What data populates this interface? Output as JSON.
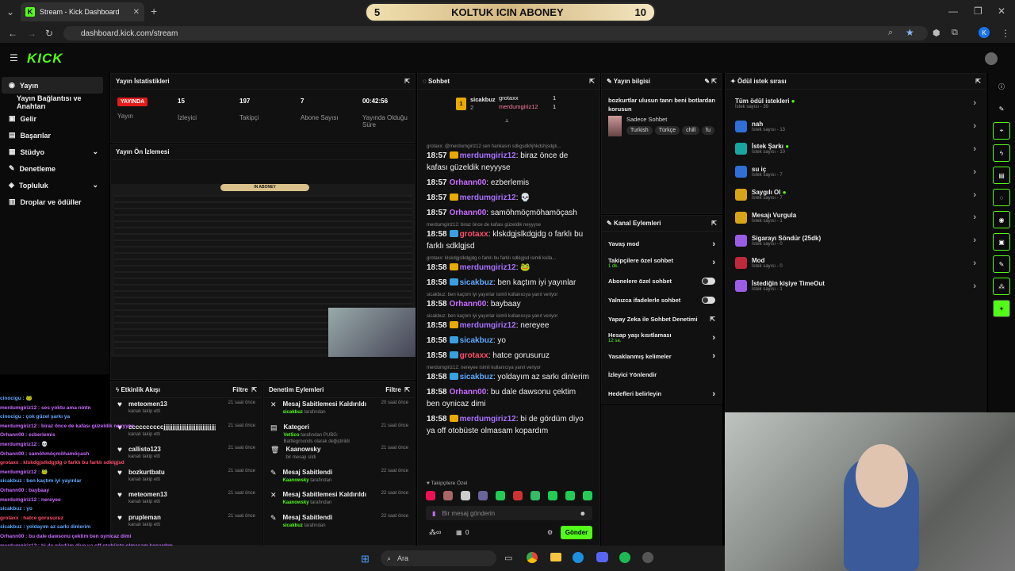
{
  "browser": {
    "tab_title": "Stream - Kick Dashboard",
    "url": "dashboard.kick.com/stream"
  },
  "overlay": {
    "left_num": "5",
    "title": "KOLTUK ICIN ABONEY",
    "right_num": "10"
  },
  "sidebar": {
    "items": [
      {
        "label": "Yayın"
      },
      {
        "label": "Yayın Bağlantısı ve Anahtarı"
      },
      {
        "label": "Gelir"
      },
      {
        "label": "Başarılar"
      },
      {
        "label": "Stüdyo"
      },
      {
        "label": "Denetleme"
      },
      {
        "label": "Topluluk"
      },
      {
        "label": "Droplar ve ödüller"
      }
    ]
  },
  "stats": {
    "title": "Yayın İstatistikleri",
    "live": "YAYINDA",
    "stream_label": "Yayın",
    "viewers": "15",
    "viewers_label": "İzleyici",
    "followers": "197",
    "followers_label": "Takipçi",
    "subs": "7",
    "subs_label": "Abone Sayısı",
    "duration": "00:42:56",
    "duration_label": "Yayında Olduğu Süre"
  },
  "preview": {
    "title": "Yayın Ön İzlemesi",
    "inner_title": "IN ABONEY",
    "inner_num": "10"
  },
  "activity": {
    "title": "Etkinlik Akışı",
    "filter": "Filtre",
    "rows": [
      {
        "name": "meteomen13",
        "sub": "kanalı takip etti",
        "time": "21 saat önce"
      },
      {
        "name": "ccccccccccjjjjjjjjjjjjjjjjjjjjjjjjjjjjjjjjjjjjjjjj",
        "sub": "kanalı takip etti",
        "time": "21 saat önce"
      },
      {
        "name": "callisto123",
        "sub": "kanalı takip etti",
        "time": "21 saat önce"
      },
      {
        "name": "bozkurtbatu",
        "sub": "kanalı takip etti",
        "time": "21 saat önce"
      },
      {
        "name": "meteomen13",
        "sub": "kanalı takip etti",
        "time": "21 saat önce"
      },
      {
        "name": "prupleman",
        "sub": "kanalı takip etti",
        "time": "21 saat önce"
      }
    ]
  },
  "moderation": {
    "title": "Denetim Eylemleri",
    "filter": "Filtre",
    "rows": [
      {
        "title": "Mesaj Sabitlemesi Kaldırıldı",
        "user": "sicakbuz",
        "rest": "tarafından",
        "time": "20 saat önce"
      },
      {
        "title": "Kategori",
        "user": "VetSco",
        "rest": "tarafından PUBG: Battlegrounds olarak değiştirildi",
        "time": "21 saat önce"
      },
      {
        "title": "Kaanowsky",
        "user": "",
        "rest": "bir mesajı sildi",
        "time": "21 saat önce"
      },
      {
        "title": "Mesaj Sabitlendi",
        "user": "Kaanowsky",
        "rest": "tarafından",
        "time": "22 saat önce"
      },
      {
        "title": "Mesaj Sabitlemesi Kaldırıldı",
        "user": "Kaanowsky",
        "rest": "tarafından",
        "time": "22 saat önce"
      },
      {
        "title": "Mesaj Sabitlendi",
        "user": "sicakbuz",
        "rest": "tarafından",
        "time": "22 saat önce"
      }
    ]
  },
  "chat": {
    "title": "Sohbet",
    "top1": "sicakbuz",
    "top1c": "1",
    "top2": "grotaxx",
    "top2c": "1",
    "top3": "merdumgiriz12",
    "top3c": "1",
    "rank2": "2",
    "rank3": "3",
    "followers_only": "Takipçilere Özel",
    "placeholder": "Bir mesaj gönderin",
    "send": "Gönder",
    "count": "0",
    "messages": [
      {
        "reply": "grotaxx: @merdumgiriz12 sen hankasın sdkgsdkhjhkdshjsdgk...",
        "time": "18:57",
        "user": "merdumgiriz12",
        "cls": "u1",
        "text": "biraz önce de kafası güzeldik neyyyse"
      },
      {
        "reply": "",
        "time": "18:57",
        "user": "Orhann00",
        "cls": "u2",
        "text": "ezberlemis"
      },
      {
        "reply": "",
        "time": "18:57",
        "user": "merdumgiriz12",
        "cls": "u1",
        "text": "💀"
      },
      {
        "reply": "",
        "time": "18:57",
        "user": "Orhann00",
        "cls": "u2",
        "text": "samöhmöçmöhamöçash"
      },
      {
        "reply": "merdumgiriz12: biraz önce de kafası güzeldik neyyyse",
        "time": "18:58",
        "user": "grotaxx",
        "cls": "u4",
        "text": "klskdgjslkdgjdg o farklı bu farklı sdklgjsd"
      },
      {
        "reply": "grotaxx: klskdgjslkdgjdg o farklı bu farklı sdklgjsd isimli kulla...",
        "time": "18:58",
        "user": "merdumgiriz12",
        "cls": "u1",
        "text": "🐸"
      },
      {
        "reply": "",
        "time": "18:58",
        "user": "sicakbuz",
        "cls": "u3",
        "text": "ben kaçtım iyi yayınlar"
      },
      {
        "reply": "sicakbuz: ben kaçtım iyi yayınlar isimli kullanıcıya yanıt veriyor",
        "time": "18:58",
        "user": "Orhann00",
        "cls": "u2",
        "text": "baybaay"
      },
      {
        "reply": "sicakbuz: ben kaçtım iyi yayınlar isimli kullanıcıya yanıt veriyor",
        "time": "18:58",
        "user": "merdumgiriz12",
        "cls": "u1",
        "text": "nereyee"
      },
      {
        "reply": "",
        "time": "18:58",
        "user": "sicakbuz",
        "cls": "u3",
        "text": "yo"
      },
      {
        "reply": "",
        "time": "18:58",
        "user": "grotaxx",
        "cls": "u4",
        "text": "hatce gorusuruz"
      },
      {
        "reply": "merdumgiriz12: nereyee isimli kullanıcıya yanıt veriyor",
        "time": "18:58",
        "user": "sicakbuz",
        "cls": "u3",
        "text": "yoldayım az sarkı dinlerim"
      },
      {
        "reply": "",
        "time": "18:58",
        "user": "Orhann00",
        "cls": "u2",
        "text": "bu dale dawsonu çektim ben oynicaz dimi"
      },
      {
        "reply": "",
        "time": "18:58",
        "user": "merdumgiriz12",
        "cls": "u1",
        "text": "bi de gördüm diyo ya off otobüste olmasam kopardım"
      }
    ]
  },
  "stream_info": {
    "title": "Yayın bilgisi",
    "desc": "bozkurtlar ulusun tanrı beni botlardan korusun",
    "chat_mode": "Sadece Sohbet",
    "tags": [
      "Turkish",
      "Türkçe",
      "chill",
      "fu"
    ]
  },
  "channel_actions": {
    "title": "Kanal Eylemleri",
    "rows": [
      {
        "label": "Yavaş mod",
        "sub": ""
      },
      {
        "label": "Takipçilere özel sohbet",
        "sub": "1 dk."
      },
      {
        "label": "Abonelere özel sohbet",
        "sub": ""
      },
      {
        "label": "Yalnızca ifadelerle sohbet",
        "sub": ""
      },
      {
        "label": "Yapay Zeka ile Sohbet Denetimi",
        "sub": ""
      },
      {
        "label": "Hesap yaşı kısıtlaması",
        "sub": "12 sa."
      },
      {
        "label": "Yasaklanmış kelimeler",
        "sub": ""
      },
      {
        "label": "İzleyici Yönlendir",
        "sub": ""
      },
      {
        "label": "Hedefleri belirleyin",
        "sub": ""
      }
    ]
  },
  "rewards": {
    "title": "Ödül istek sırası",
    "all": "Tüm ödül istekleri",
    "all_count": "İstek sayısı - 39",
    "items": [
      {
        "name": "nah",
        "count": "İstek sayısı - 13",
        "color": "#2f6fd6"
      },
      {
        "name": "İstek Şarkı",
        "count": "İstek sayısı - 10",
        "color": "#18a7a0"
      },
      {
        "name": "su iç",
        "count": "İstek sayısı - 7",
        "color": "#2f6fd6"
      },
      {
        "name": "Saygılı Ol",
        "count": "İstek sayısı - 7",
        "color": "#d9a318"
      },
      {
        "name": "Mesajı Vurgula",
        "count": "İstek sayısı - 1",
        "color": "#d9a318"
      },
      {
        "name": "Sigarayı Söndür (25dk)",
        "count": "İstek sayısı - 0",
        "color": "#9b5de5"
      },
      {
        "name": "Mod",
        "count": "İstek sayısı - 0",
        "color": "#c0283d"
      },
      {
        "name": "İstediğin kişiye TimeOut",
        "count": "İstek sayısı - 1",
        "color": "#9b5de5"
      }
    ]
  },
  "overlay_chat": [
    "cinocigu : 🐸",
    "merdumgiriz12 : ses yoktu ama nintn",
    "cinocigu : çok güzel şarkı ya",
    "merdumgiriz12 : biraz önce de kafası güzeldik neyyyse",
    "Orhann00 : ezberlemis",
    "merdumgiriz12 : 💀",
    "Orhann00 : samöhmöçmöhamöçash",
    "grotaxx : klskdgjslkdgjdg o farklı bu farklı sdklgjsd",
    "merdumgiriz12 : 🐸",
    "sicakbuz : ben kaçtım iyi yayınlar",
    "Orhann00 : baybaay",
    "merdumgiriz12 : nereyee",
    "sicakbuz : yo",
    "grotaxx : hatce gorusuruz",
    "sicakbuz : yoldayım az sarkı dinlerim",
    "Orhann00 : bu dale dawsonu çektim ben oynicaz dimi",
    "merdumgiriz12 : bi de gördüm diyo ya off otobüste olmasam kopardım"
  ],
  "taskbar": {
    "search": "Ara"
  },
  "colors": {
    "accent": "#53fc18",
    "bg": "#0b0b0b",
    "panel": "#111111"
  }
}
